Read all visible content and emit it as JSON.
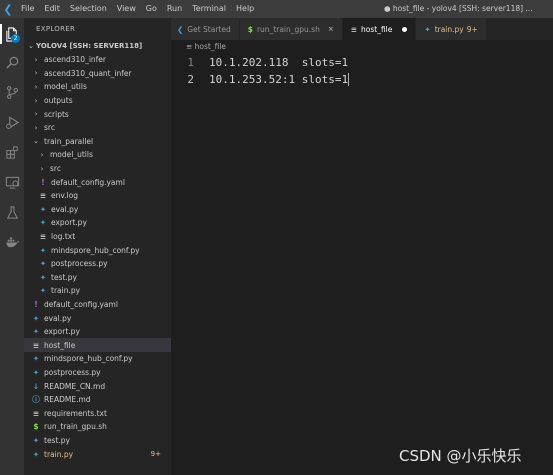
{
  "menu": [
    "File",
    "Edit",
    "Selection",
    "View",
    "Go",
    "Run",
    "Terminal",
    "Help"
  ],
  "window_title": "● host_file - yolov4 [SSH: server118] ...",
  "activity": {
    "explorer_badge": "2"
  },
  "sidebar": {
    "header": "EXPLORER",
    "root": "YOLOV4 [SSH: SERVER118]",
    "items": [
      {
        "label": "ascend310_infer",
        "type": "folder",
        "indent": 0
      },
      {
        "label": "ascend310_quant_infer",
        "type": "folder",
        "indent": 0
      },
      {
        "label": "model_utils",
        "type": "folder",
        "indent": 0
      },
      {
        "label": "outputs",
        "type": "folder",
        "indent": 0
      },
      {
        "label": "scripts",
        "type": "folder",
        "indent": 0
      },
      {
        "label": "src",
        "type": "folder",
        "indent": 0
      },
      {
        "label": "train_parallel",
        "type": "folder-open",
        "indent": 0
      },
      {
        "label": "model_utils",
        "type": "folder",
        "indent": 1
      },
      {
        "label": "src",
        "type": "folder",
        "indent": 1
      },
      {
        "label": "default_config.yaml",
        "type": "yaml",
        "indent": 1
      },
      {
        "label": "env.log",
        "type": "text",
        "indent": 1
      },
      {
        "label": "eval.py",
        "type": "python",
        "indent": 1
      },
      {
        "label": "export.py",
        "type": "python",
        "indent": 1
      },
      {
        "label": "log.txt",
        "type": "text",
        "indent": 1
      },
      {
        "label": "mindspore_hub_conf.py",
        "type": "python",
        "indent": 1
      },
      {
        "label": "postprocess.py",
        "type": "python",
        "indent": 1
      },
      {
        "label": "test.py",
        "type": "python",
        "indent": 1
      },
      {
        "label": "train.py",
        "type": "python",
        "indent": 1
      },
      {
        "label": "default_config.yaml",
        "type": "yaml",
        "indent": 0
      },
      {
        "label": "eval.py",
        "type": "python",
        "indent": 0
      },
      {
        "label": "export.py",
        "type": "python",
        "indent": 0
      },
      {
        "label": "host_file",
        "type": "plain",
        "indent": 0,
        "selected": true
      },
      {
        "label": "mindspore_hub_conf.py",
        "type": "python",
        "indent": 0
      },
      {
        "label": "postprocess.py",
        "type": "python",
        "indent": 0
      },
      {
        "label": "README_CN.md",
        "type": "markdown",
        "indent": 0
      },
      {
        "label": "README.md",
        "type": "info",
        "indent": 0
      },
      {
        "label": "requirements.txt",
        "type": "text",
        "indent": 0
      },
      {
        "label": "run_train_gpu.sh",
        "type": "shell",
        "indent": 0
      },
      {
        "label": "test.py",
        "type": "python",
        "indent": 0
      },
      {
        "label": "train.py",
        "type": "python",
        "indent": 0,
        "modified": "9+"
      }
    ]
  },
  "tabs": [
    {
      "label": "Get Started",
      "icon": "vscode-icon",
      "state": "normal"
    },
    {
      "label": "run_train_gpu.sh",
      "icon": "shell-icon",
      "state": "close"
    },
    {
      "label": "host_file",
      "icon": "file-icon",
      "state": "dirty",
      "active": true
    },
    {
      "label": "train.py",
      "icon": "python-icon",
      "state": "modified",
      "count": "9+"
    }
  ],
  "breadcrumb": "host_file",
  "editor": {
    "lines": [
      {
        "num": "1",
        "text": "10.1.202.118  slots=1"
      },
      {
        "num": "2",
        "text": "10.1.253.52:1 slots=1"
      }
    ]
  },
  "watermark": "CSDN @小乐快乐",
  "colors": {
    "accent": "#007acc",
    "python": "#519aba",
    "yaml": "#a074c4",
    "shell": "#89e051",
    "markdown": "#519aba",
    "modified": "#e2c08d"
  }
}
